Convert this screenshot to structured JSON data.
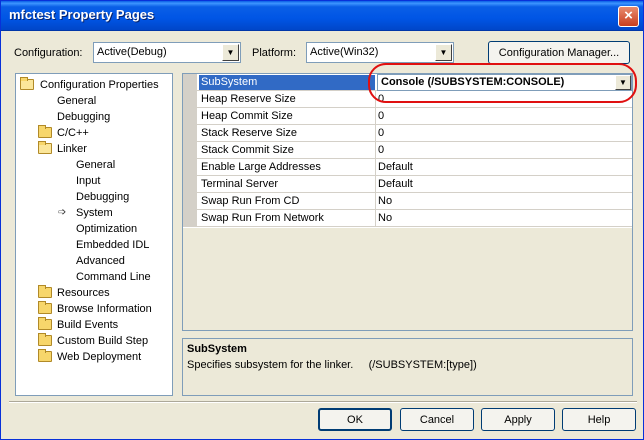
{
  "window": {
    "title": "mfctest Property Pages",
    "close_glyph": "×"
  },
  "toolbar": {
    "configuration_label": "Configuration:",
    "configuration_value": "Active(Debug)",
    "platform_label": "Platform:",
    "platform_value": "Active(Win32)",
    "config_manager_label": "Configuration Manager..."
  },
  "tree": {
    "root": "Configuration Properties",
    "general": "General",
    "debugging": "Debugging",
    "cpp": "C/C++",
    "linker": "Linker",
    "linker_general": "General",
    "linker_input": "Input",
    "linker_debugging": "Debugging",
    "linker_system": "System",
    "linker_optimization": "Optimization",
    "linker_embedded_idl": "Embedded IDL",
    "linker_advanced": "Advanced",
    "linker_command_line": "Command Line",
    "resources": "Resources",
    "browse_information": "Browse Information",
    "build_events": "Build Events",
    "custom_build_step": "Custom Build Step",
    "web_deployment": "Web Deployment"
  },
  "grid": {
    "rows": [
      {
        "name": "SubSystem",
        "value": "Console (/SUBSYSTEM:CONSOLE)"
      },
      {
        "name": "Heap Reserve Size",
        "value": "0"
      },
      {
        "name": "Heap Commit Size",
        "value": "0"
      },
      {
        "name": "Stack Reserve Size",
        "value": "0"
      },
      {
        "name": "Stack Commit Size",
        "value": "0"
      },
      {
        "name": "Enable Large Addresses",
        "value": "Default"
      },
      {
        "name": "Terminal Server",
        "value": "Default"
      },
      {
        "name": "Swap Run From CD",
        "value": "No"
      },
      {
        "name": "Swap Run From Network",
        "value": "No"
      }
    ]
  },
  "description": {
    "title": "SubSystem",
    "text": "Specifies subsystem for the linker.     (/SUBSYSTEM:[type])"
  },
  "buttons": {
    "ok": "OK",
    "cancel": "Cancel",
    "apply": "Apply",
    "help": "Help"
  },
  "colors": {
    "selection": "#316ac5",
    "highlight_ring": "#e01010",
    "titlebar": "#0a5fe6"
  }
}
